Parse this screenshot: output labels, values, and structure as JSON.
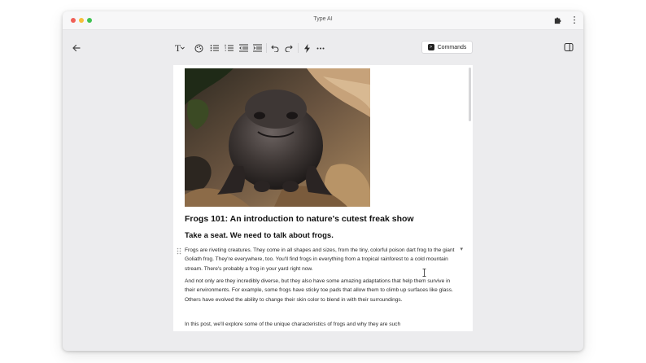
{
  "window": {
    "title": "Type AI"
  },
  "toolbar": {
    "text_style_label": "T",
    "buttons": [
      "text-style",
      "ai-palette",
      "bullet-list",
      "numbered-list",
      "outdent",
      "indent",
      "undo",
      "redo",
      "ai-lightning",
      "more"
    ]
  },
  "commands": {
    "label": "Commands"
  },
  "document": {
    "title": "Frogs 101: An introduction to nature's cutest freak show",
    "subtitle": "Take a seat. We need to talk about frogs.",
    "paragraphs": [
      "Frogs are riveting creatures. They come in all shapes and sizes, from the tiny, colorful poison dart frog to the giant Goliath frog. They're everywhere, too. You'll find frogs in everything from a tropical rainforest to a cold mountain stream. There's probably a frog in your yard right now.",
      "And not only are they incredibly diverse, but they also have some amazing adaptations that help them survive in their environments. For example, some frogs have sticky toe pads that allow them to climb up surfaces like glass. Others have evolved the ability to change their skin color to blend in with their surroundings.",
      "In this post, we'll explore some of the unique characteristics of frogs and why they are such"
    ]
  },
  "colors": {
    "window_bg": "#ececee",
    "titlebar_bg": "#f7f7f8",
    "doc_bg": "#ffffff",
    "text": "#111111",
    "traffic_red": "#f05f57",
    "traffic_yellow": "#f6bf3a",
    "traffic_green": "#3fc251"
  }
}
